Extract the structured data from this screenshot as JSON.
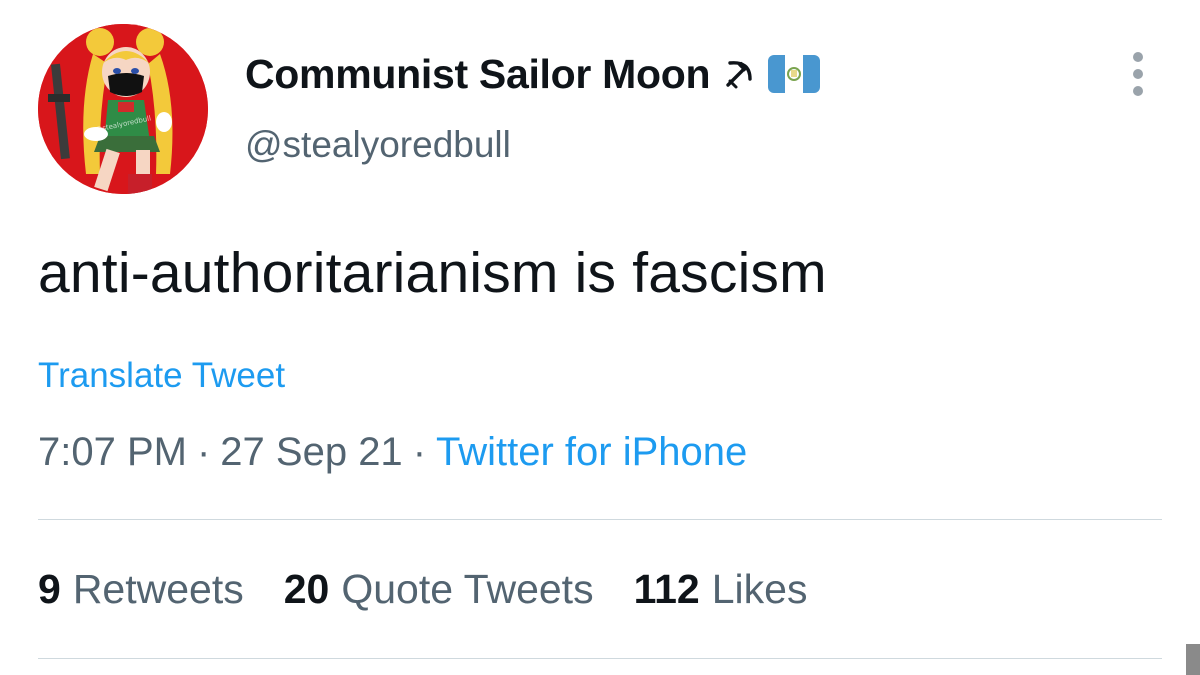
{
  "author": {
    "display_name": "Communist Sailor Moon",
    "name_emojis": [
      "hammer-and-sickle-icon",
      "guatemala-flag-icon"
    ],
    "handle": "@stealyoredbull",
    "avatar_watermark": "@stealyoredbull"
  },
  "tweet": {
    "text": "anti-authoritarianism is fascism",
    "translate_label": "Translate Tweet",
    "time": "7:07 PM",
    "separator": "·",
    "date": "27 Sep 21",
    "source": "Twitter for iPhone"
  },
  "stats": {
    "retweets_count": "9",
    "retweets_label": "Retweets",
    "quotes_count": "20",
    "quotes_label": "Quote Tweets",
    "likes_count": "112",
    "likes_label": "Likes"
  },
  "colors": {
    "link": "#1d9bf0",
    "secondary_text": "#536471",
    "primary_text": "#0f1419",
    "divider": "#cfd9de",
    "avatar_background": "#d8161b"
  }
}
